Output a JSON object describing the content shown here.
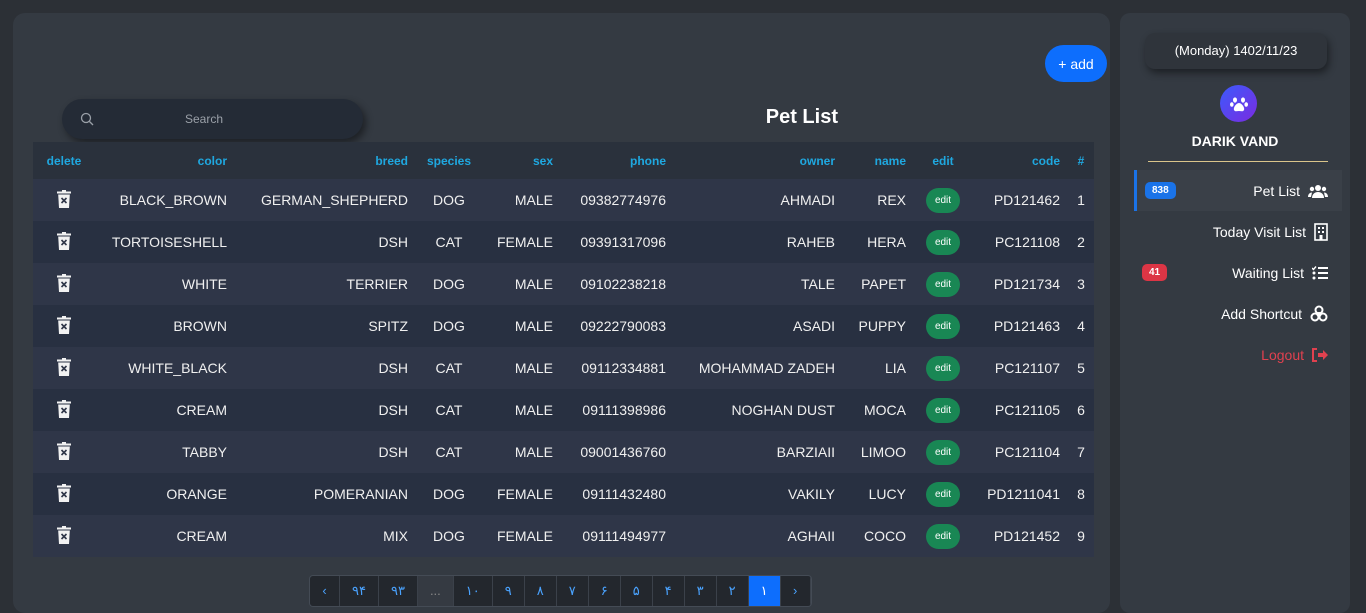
{
  "header": {
    "add_label": "+ add",
    "title": "Pet List",
    "search_placeholder": "Search"
  },
  "table": {
    "columns": [
      "delete",
      "color",
      "breed",
      "species",
      "sex",
      "phone",
      "owner",
      "name",
      "edit",
      "code",
      "#"
    ],
    "edit_label": "edit",
    "rows": [
      {
        "color": "BLACK_BROWN",
        "breed": "GERMAN_SHEPHERD",
        "species": "DOG",
        "sex": "MALE",
        "phone": "09382774976",
        "owner": "AHMADI",
        "name": "REX",
        "code": "PD121462",
        "num": "1"
      },
      {
        "color": "TORTOISESHELL",
        "breed": "DSH",
        "species": "CAT",
        "sex": "FEMALE",
        "phone": "09391317096",
        "owner": "RAHEB",
        "name": "HERA",
        "code": "PC121108",
        "num": "2"
      },
      {
        "color": "WHITE",
        "breed": "TERRIER",
        "species": "DOG",
        "sex": "MALE",
        "phone": "09102238218",
        "owner": "TALE",
        "name": "PAPET",
        "code": "PD121734",
        "num": "3"
      },
      {
        "color": "BROWN",
        "breed": "SPITZ",
        "species": "DOG",
        "sex": "MALE",
        "phone": "09222790083",
        "owner": "ASADI",
        "name": "PUPPY",
        "code": "PD121463",
        "num": "4"
      },
      {
        "color": "WHITE_BLACK",
        "breed": "DSH",
        "species": "CAT",
        "sex": "MALE",
        "phone": "09112334881",
        "owner": "MOHAMMAD ZADEH",
        "name": "LIA",
        "code": "PC121107",
        "num": "5"
      },
      {
        "color": "CREAM",
        "breed": "DSH",
        "species": "CAT",
        "sex": "MALE",
        "phone": "09111398986",
        "owner": "NOGHAN DUST",
        "name": "MOCA",
        "code": "PC121105",
        "num": "6"
      },
      {
        "color": "TABBY",
        "breed": "DSH",
        "species": "CAT",
        "sex": "MALE",
        "phone": "09001436760",
        "owner": "BARZIAII",
        "name": "LIMOO",
        "code": "PC121104",
        "num": "7"
      },
      {
        "color": "ORANGE",
        "breed": "POMERANIAN",
        "species": "DOG",
        "sex": "FEMALE",
        "phone": "09111432480",
        "owner": "VAKILY",
        "name": "LUCY",
        "code": "PD1211041",
        "num": "8"
      },
      {
        "color": "CREAM",
        "breed": "MIX",
        "species": "DOG",
        "sex": "FEMALE",
        "phone": "09111494977",
        "owner": "AGHAII",
        "name": "COCO",
        "code": "PD121452",
        "num": "9"
      }
    ]
  },
  "pagination": {
    "prev": "‹",
    "next": "›",
    "pages": [
      "۹۴",
      "۹۳",
      "...",
      "۱۰",
      "۹",
      "۸",
      "۷",
      "۶",
      "۵",
      "۴",
      "۳",
      "۲",
      "۱"
    ],
    "active": "۱"
  },
  "sidebar": {
    "date": "(Monday) 1402/11/23",
    "user": "DARIK VAND",
    "items": [
      {
        "label": "Pet List",
        "badge": "838",
        "badge_color": "#1a73e8",
        "icon": "users-icon"
      },
      {
        "label": "Today Visit List",
        "icon": "building-icon"
      },
      {
        "label": "Waiting List",
        "badge": "41",
        "badge_color": "#dc3545",
        "icon": "list-check-icon"
      },
      {
        "label": "Add Shortcut",
        "icon": "biohazard-icon"
      },
      {
        "label": "Logout",
        "icon": "logout-icon",
        "color": "#e0414f"
      }
    ]
  }
}
